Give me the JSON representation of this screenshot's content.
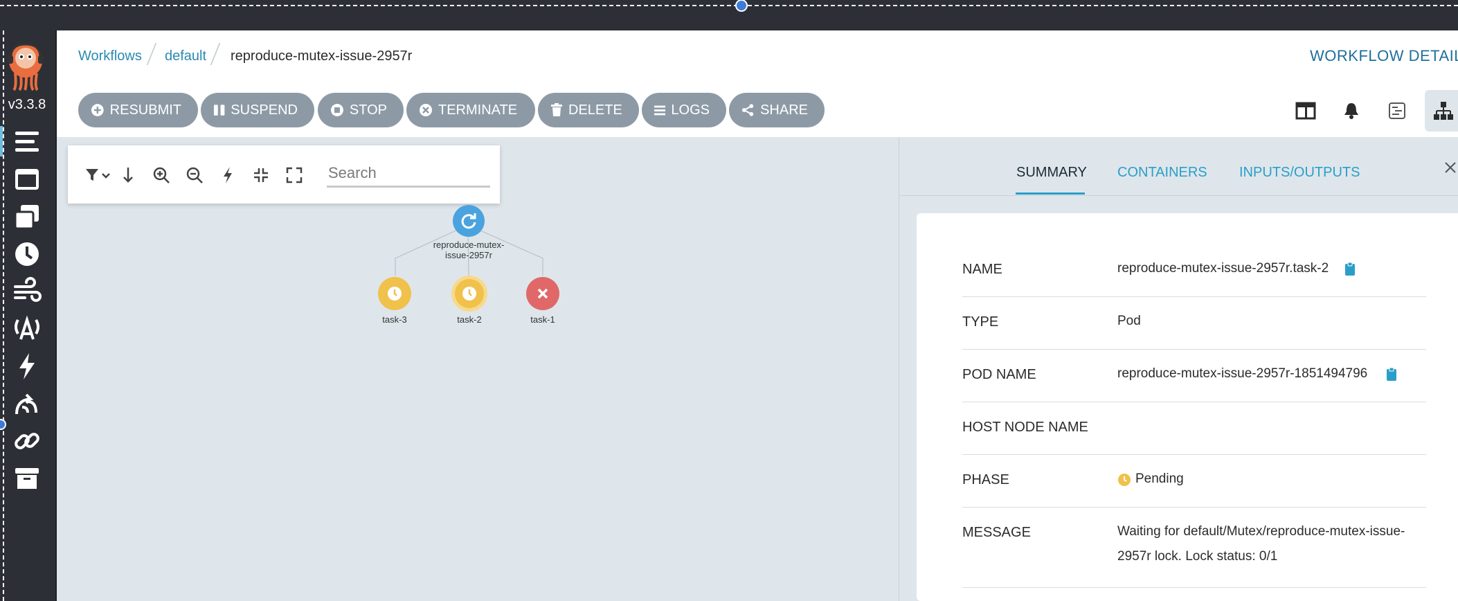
{
  "app": {
    "version": "v3.3.8"
  },
  "breadcrumb": {
    "items": [
      "Workflows",
      "default"
    ],
    "current": "reproduce-mutex-issue-2957r"
  },
  "page_title": "WORKFLOW DETAILS",
  "toolbar": {
    "resubmit": "RESUBMIT",
    "suspend": "SUSPEND",
    "stop": "STOP",
    "terminate": "TERMINATE",
    "delete": "DELETE",
    "logs": "LOGS",
    "share": "SHARE"
  },
  "graph": {
    "search_placeholder": "Search",
    "root_label_line1": "reproduce-mutex-",
    "root_label_line2": "issue-2957r",
    "nodes": [
      {
        "name": "task-3",
        "status": "pending"
      },
      {
        "name": "task-2",
        "status": "pending"
      },
      {
        "name": "task-1",
        "status": "failed"
      }
    ]
  },
  "panel": {
    "tabs": [
      "SUMMARY",
      "CONTAINERS",
      "INPUTS/OUTPUTS"
    ],
    "active_tab": "SUMMARY",
    "fields": {
      "name_label": "NAME",
      "name_value": "reproduce-mutex-issue-2957r.task-2",
      "type_label": "TYPE",
      "type_value": "Pod",
      "pod_label": "POD NAME",
      "pod_value": "reproduce-mutex-issue-2957r-1851494796",
      "host_label": "HOST NODE NAME",
      "host_value": "",
      "phase_label": "PHASE",
      "phase_value": "Pending",
      "message_label": "MESSAGE",
      "message_line1": "Waiting for default/Mutex/reproduce-mutex-issue-",
      "message_line2": "2957r lock. Lock status: 0/1"
    }
  },
  "colors": {
    "accent": "#2a9ec9",
    "button": "#8d9aa6",
    "sidebar": "#2c2f36",
    "running": "#4aa3df",
    "pending": "#f0c14b",
    "failed": "#e06868"
  }
}
